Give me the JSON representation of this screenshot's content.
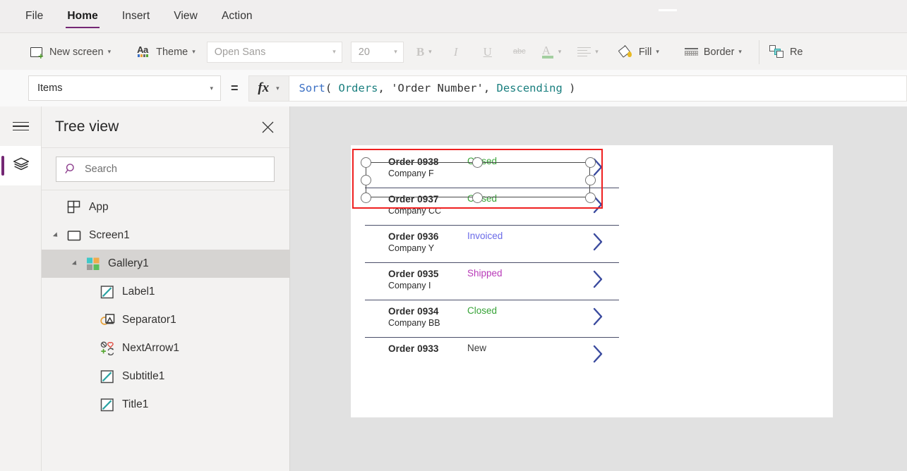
{
  "menu": {
    "items": [
      {
        "label": "File",
        "active": false
      },
      {
        "label": "Home",
        "active": true
      },
      {
        "label": "Insert",
        "active": false
      },
      {
        "label": "View",
        "active": false
      },
      {
        "label": "Action",
        "active": false
      }
    ]
  },
  "ribbon": {
    "new_screen": "New screen",
    "theme": "Theme",
    "font_name": "Open Sans",
    "font_size": "20",
    "bold": "B",
    "italic": "I",
    "underline": "U",
    "strikethrough": "abc",
    "font_color": "A",
    "align": "align-icon",
    "fill": "Fill",
    "border": "Border",
    "reorder": "Re",
    "chevron": "⌄"
  },
  "formula_bar": {
    "property": "Items",
    "equals": "=",
    "fx": "fx",
    "tokens": [
      {
        "text": "Sort",
        "type": "fn"
      },
      {
        "text": "( ",
        "type": "pn"
      },
      {
        "text": "Orders",
        "type": "id"
      },
      {
        "text": ", ",
        "type": "pn"
      },
      {
        "text": "'Order Number'",
        "type": "str"
      },
      {
        "text": ", ",
        "type": "pn"
      },
      {
        "text": "Descending",
        "type": "id"
      },
      {
        "text": " )",
        "type": "pn"
      }
    ]
  },
  "rail": {
    "hamburger": "hamburger-icon",
    "tree_view_tab": "layers-icon"
  },
  "tree": {
    "title": "Tree view",
    "close": "✕",
    "search_placeholder": "Search",
    "nodes": [
      {
        "label": "App",
        "icon": "app-icon",
        "indent": 36,
        "caret": false,
        "selected": false
      },
      {
        "label": "Screen1",
        "icon": "screen-icon",
        "indent": 36,
        "caret": true,
        "selected": false
      },
      {
        "label": "Gallery1",
        "icon": "gallery-icon",
        "indent": 63,
        "caret": true,
        "selected": true
      },
      {
        "label": "Label1",
        "icon": "label-icon",
        "indent": 83,
        "caret": false,
        "selected": false
      },
      {
        "label": "Separator1",
        "icon": "separator-icon",
        "indent": 83,
        "caret": false,
        "selected": false
      },
      {
        "label": "NextArrow1",
        "icon": "next-arrow-icon",
        "indent": 83,
        "caret": false,
        "selected": false
      },
      {
        "label": "Subtitle1",
        "icon": "label-icon",
        "indent": 83,
        "caret": false,
        "selected": false
      },
      {
        "label": "Title1",
        "icon": "label-icon",
        "indent": 83,
        "caret": false,
        "selected": false
      }
    ]
  },
  "canvas": {
    "gallery_rows": [
      {
        "title": "Order 0938",
        "subtitle": "Company F",
        "status": "Closed",
        "status_color": "#36a336",
        "selected": true
      },
      {
        "title": "Order 0937",
        "subtitle": "Company CC",
        "status": "Closed",
        "status_color": "#36a336",
        "selected": false
      },
      {
        "title": "Order 0936",
        "subtitle": "Company Y",
        "status": "Invoiced",
        "status_color": "#6a6ae8",
        "selected": false
      },
      {
        "title": "Order 0935",
        "subtitle": "Company I",
        "status": "Shipped",
        "status_color": "#b83ab8",
        "selected": false
      },
      {
        "title": "Order 0934",
        "subtitle": "Company BB",
        "status": "Closed",
        "status_color": "#36a336",
        "selected": false
      },
      {
        "title": "Order 0933",
        "subtitle": "",
        "status": "New",
        "status_color": "#3a3a3a",
        "selected": false
      }
    ]
  },
  "colors": {
    "accent_purple": "#742774",
    "selection_red": "#ef2020",
    "separator_navy": "#4a4e69",
    "arrow_navy": "#3a4a9e"
  }
}
